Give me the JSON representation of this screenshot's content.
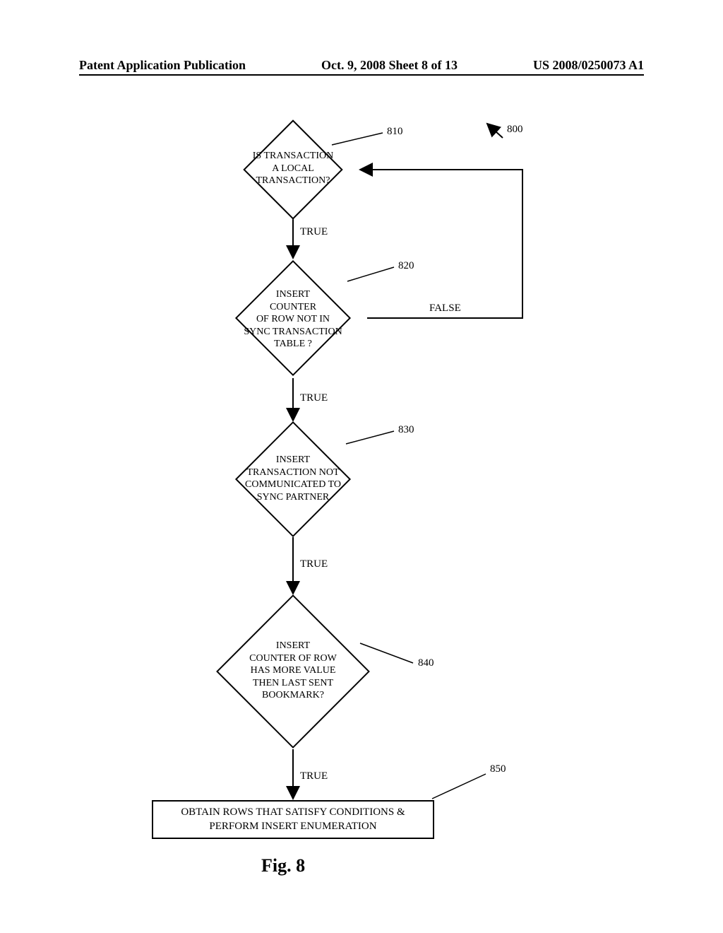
{
  "header": {
    "left": "Patent Application Publication",
    "center": "Oct. 9, 2008  Sheet 8 of 13",
    "right": "US 2008/0250073 A1"
  },
  "refs": {
    "r800": "800",
    "r810": "810",
    "r820": "820",
    "r830": "830",
    "r840": "840",
    "r850": "850"
  },
  "edges": {
    "true1": "TRUE",
    "true2": "TRUE",
    "true3": "TRUE",
    "true4": "TRUE",
    "false1": "FALSE"
  },
  "nodes": {
    "d810": "IS TRANSACTION\nA LOCAL\nTRANSACTION?",
    "d820": "INSERT\nCOUNTER\nOF ROW NOT IN\nSYNC TRANSACTION\nTABLE ?",
    "d830": "INSERT\nTRANSACTION NOT\nCOMMUNICATED TO\nSYNC PARTNER",
    "d840": "INSERT\nCOUNTER OF ROW\nHAS MORE VALUE\nTHEN LAST SENT\nBOOKMARK?",
    "box850": "OBTAIN ROWS THAT SATISFY CONDITIONS &\nPERFORM INSERT ENUMERATION"
  },
  "caption": "Fig. 8",
  "chart_data": {
    "type": "flowchart",
    "title": "Fig. 8",
    "nodes": [
      {
        "id": "810",
        "type": "decision",
        "text": "IS TRANSACTION A LOCAL TRANSACTION?"
      },
      {
        "id": "820",
        "type": "decision",
        "text": "INSERT COUNTER OF ROW NOT IN SYNC TRANSACTION TABLE ?"
      },
      {
        "id": "830",
        "type": "decision",
        "text": "INSERT TRANSACTION NOT COMMUNICATED TO SYNC PARTNER"
      },
      {
        "id": "840",
        "type": "decision",
        "text": "INSERT COUNTER OF ROW HAS MORE VALUE THEN LAST SENT BOOKMARK?"
      },
      {
        "id": "850",
        "type": "process",
        "text": "OBTAIN ROWS THAT SATISFY CONDITIONS & PERFORM INSERT ENUMERATION"
      }
    ],
    "edges": [
      {
        "from": "810",
        "to": "820",
        "label": "TRUE"
      },
      {
        "from": "820",
        "to": "830",
        "label": "TRUE"
      },
      {
        "from": "820",
        "to": "810",
        "label": "FALSE"
      },
      {
        "from": "830",
        "to": "840",
        "label": "TRUE"
      },
      {
        "from": "840",
        "to": "850",
        "label": "TRUE"
      }
    ],
    "overall_ref": "800"
  }
}
